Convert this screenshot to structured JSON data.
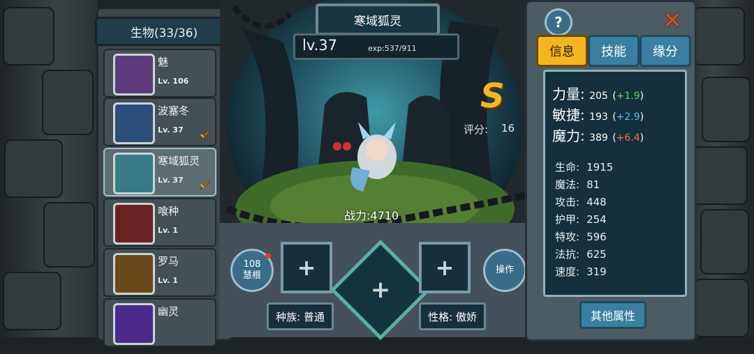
{
  "left": {
    "header": "生物(33/36)",
    "creatures": [
      {
        "name": "魅",
        "level": "Lv. 106",
        "has_sword": false,
        "selected": false
      },
      {
        "name": "波塞冬",
        "level": "Lv. 37",
        "has_sword": true,
        "selected": false
      },
      {
        "name": "寒域狐灵",
        "level": "Lv. 37",
        "has_sword": true,
        "selected": true
      },
      {
        "name": "喰种",
        "level": "Lv. 1",
        "has_sword": false,
        "selected": false
      },
      {
        "name": "罗马",
        "level": "Lv. 1",
        "has_sword": false,
        "selected": false
      },
      {
        "name": "幽灵",
        "level": "",
        "has_sword": false,
        "selected": false
      }
    ]
  },
  "center": {
    "name": "寒域狐灵",
    "level": "lv.37",
    "exp": "exp:537/911",
    "grade": "S",
    "score_label": "评分:",
    "score_value": "16",
    "power": "战力:4710",
    "slot_symbol": "+",
    "huigen_count": "108",
    "huigen_label": "慧根",
    "operate_label": "操作",
    "race": "种族: 普通",
    "personality": "性格: 傲娇"
  },
  "right": {
    "help": "?",
    "close": "✕",
    "tabs": [
      "信息",
      "技能",
      "缘分"
    ],
    "active_tab": 0,
    "main_stats": [
      {
        "label": "力量:",
        "value": "205",
        "bonus": "+1.9",
        "bonus_color": "green"
      },
      {
        "label": "敏捷:",
        "value": "193",
        "bonus": "+2.9",
        "bonus_color": "blue"
      },
      {
        "label": "魔力:",
        "value": "389",
        "bonus": "+6.4",
        "bonus_color": "red"
      }
    ],
    "stats": [
      {
        "label": "生命:",
        "value": "1915"
      },
      {
        "label": "魔法:",
        "value": "81"
      },
      {
        "label": "攻击:",
        "value": "448"
      },
      {
        "label": "护甲:",
        "value": "254"
      },
      {
        "label": "特攻:",
        "value": "596"
      },
      {
        "label": "法抗:",
        "value": "625"
      },
      {
        "label": "速度:",
        "value": "319"
      }
    ],
    "other_button": "其他属性"
  },
  "colors": {
    "accent_gold": "#f4b520",
    "accent_blue": "#3b7fa0",
    "bonus_green": "#5bd65b",
    "bonus_blue": "#5ab4ff",
    "bonus_red": "#ff6a4a"
  }
}
